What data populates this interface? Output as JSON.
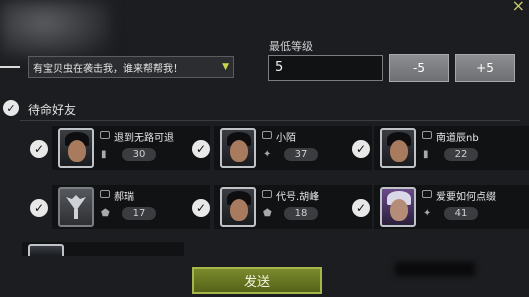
{
  "header": {
    "close_icon": "close-icon"
  },
  "message": {
    "text": "有宝贝虫在袭击我，谁来帮帮我！",
    "dropdown_icon": "triangle-down-icon"
  },
  "level": {
    "label": "最低等级",
    "value": "5",
    "minus_label": "-5",
    "plus_label": "+5"
  },
  "standby": {
    "label": "待命好友"
  },
  "friends": [
    {
      "name": "退到无路可退",
      "level": "30",
      "rank_icon": "rank-icon"
    },
    {
      "name": "小陌",
      "level": "37",
      "rank_icon": "rank-icon"
    },
    {
      "name": "南道辰nb",
      "level": "22",
      "rank_icon": "rank-icon"
    },
    {
      "name": "郝瑞",
      "level": "17",
      "rank_icon": "rank-icon"
    },
    {
      "name": "代号.胡峰",
      "level": "18",
      "rank_icon": "rank-icon"
    },
    {
      "name": "爱要如何点缀",
      "level": "41",
      "rank_icon": "rank-icon"
    }
  ],
  "footer": {
    "send_label": "发送"
  }
}
